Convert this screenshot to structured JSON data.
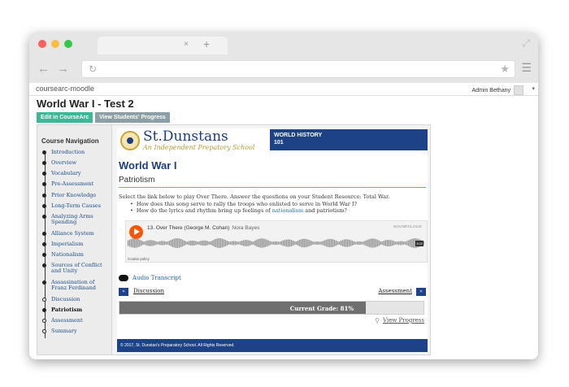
{
  "browser": {
    "lights": [
      "#fc605c",
      "#fdbc40",
      "#34c84a"
    ],
    "tab_close": "×",
    "new_tab": "+",
    "back": "←",
    "forward": "→",
    "reload": "↻",
    "star": "★",
    "menu": "☰",
    "expand": "⤢"
  },
  "moodle": {
    "brand": "coursearc-moodle",
    "user": "Admin Bethany",
    "caret": "▾"
  },
  "page": {
    "title": "World War I - Test 2",
    "edit_button": "Edit in CourseArc",
    "progress_button": "View Students' Progress"
  },
  "sidebar": {
    "heading": "Course Navigation",
    "items": [
      {
        "label": "Introduction"
      },
      {
        "label": "Overview"
      },
      {
        "label": "Vocabulary"
      },
      {
        "label": "Pre-Assessment"
      },
      {
        "label": "Prior Knowledge"
      },
      {
        "label": "Long-Term Causes"
      },
      {
        "label": "Analyzing Arms Spending"
      },
      {
        "label": "Alliance System"
      },
      {
        "label": "Imperialism"
      },
      {
        "label": "Nationalism"
      },
      {
        "label": "Sources of Conflict and Unity"
      },
      {
        "label": "Assassination of Franz Ferdinand"
      },
      {
        "label": "Discussion"
      },
      {
        "label": "Patriotism"
      },
      {
        "label": "Assessment"
      },
      {
        "label": "Summary"
      }
    ]
  },
  "school": {
    "name": "St.Dunstans",
    "tagline": "An Independent Prepatory School",
    "course_line1": "WORLD HISTORY",
    "course_line2": "101"
  },
  "lesson": {
    "title": "World War I",
    "section": "Patriotism",
    "intro": "Select the link below to play Over There. Answer the questions on your Student Resource: Total War.",
    "q1": "How does this song serve to rally the troops who enlisted to serve in World War I?",
    "q2_pre": "How do the lyrics and rhythm bring up feelings of ",
    "q2_link": "nationalism",
    "q2_post": " and patriotism?"
  },
  "player": {
    "track": "13. Over There (George M. Cohan)",
    "artist": "Nora Bayes",
    "logo": "SOUNDCLOUD",
    "duration": "3:02",
    "cookie": "Cookie policy"
  },
  "transcript": "Audio Transcript",
  "pager": {
    "prev_icon": "«",
    "prev": "Discussion",
    "next": "Assessment",
    "next_icon": "»"
  },
  "grade": {
    "label": "Current Grade: 81%",
    "percent": 81
  },
  "view_progress": "View Progress",
  "footer": "© 2017, St. Dunstan's Preparatory School. All Rights Reserved."
}
